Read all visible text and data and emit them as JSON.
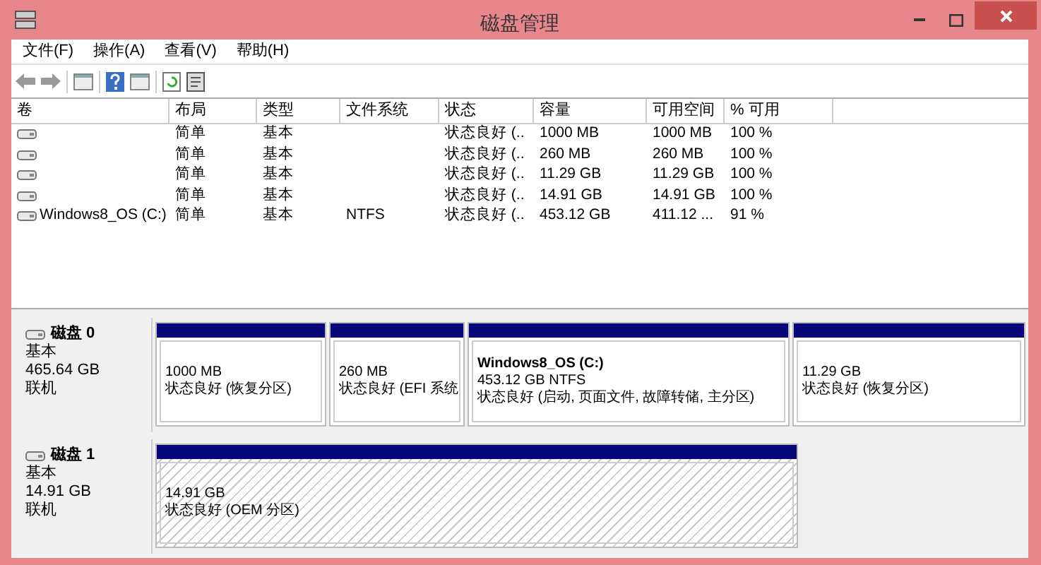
{
  "window": {
    "title": "磁盘管理"
  },
  "menu": [
    "文件(F)",
    "操作(A)",
    "查看(V)",
    "帮助(H)"
  ],
  "table": {
    "columns": [
      "卷",
      "布局",
      "类型",
      "文件系统",
      "状态",
      "容量",
      "可用空间",
      "% 可用"
    ],
    "rows": [
      {
        "cells": [
          "",
          "简单",
          "基本",
          "",
          "状态良好 (..",
          "1000 MB",
          "1000 MB",
          "100 %"
        ]
      },
      {
        "cells": [
          "",
          "简单",
          "基本",
          "",
          "状态良好 (..",
          "260 MB",
          "260 MB",
          "100 %"
        ]
      },
      {
        "cells": [
          "",
          "简单",
          "基本",
          "",
          "状态良好 (..",
          "11.29 GB",
          "11.29 GB",
          "100 %"
        ]
      },
      {
        "cells": [
          "",
          "简单",
          "基本",
          "",
          "状态良好 (..",
          "14.91 GB",
          "14.91 GB",
          "100 %"
        ]
      },
      {
        "cells": [
          "Windows8_OS (C:)",
          "简单",
          "基本",
          "NTFS",
          "状态良好 (..",
          "453.12 GB",
          "411.12 ...",
          "91 %"
        ]
      }
    ]
  },
  "disks": [
    {
      "name": "磁盘 0",
      "type": "基本",
      "size": "465.64 GB",
      "status": "联机",
      "partitions": [
        {
          "size": "1000 MB",
          "status": "状态良好 (恢复分区)",
          "hatched": false
        },
        {
          "size": "260 MB",
          "status": "状态良好 (EFI 系统",
          "hatched": false
        },
        {
          "name": "Windows8_OS  (C:)",
          "size": "453.12 GB NTFS",
          "status": "状态良好 (启动, 页面文件, 故障转储, 主分区)",
          "hatched": false
        },
        {
          "size": "11.29 GB",
          "status": "状态良好 (恢复分区)",
          "hatched": false
        }
      ]
    },
    {
      "name": "磁盘 1",
      "type": "基本",
      "size": "14.91 GB",
      "status": "联机",
      "partitions": [
        {
          "size": "14.91 GB",
          "status": "状态良好 (OEM 分区)",
          "hatched": true
        }
      ]
    }
  ]
}
